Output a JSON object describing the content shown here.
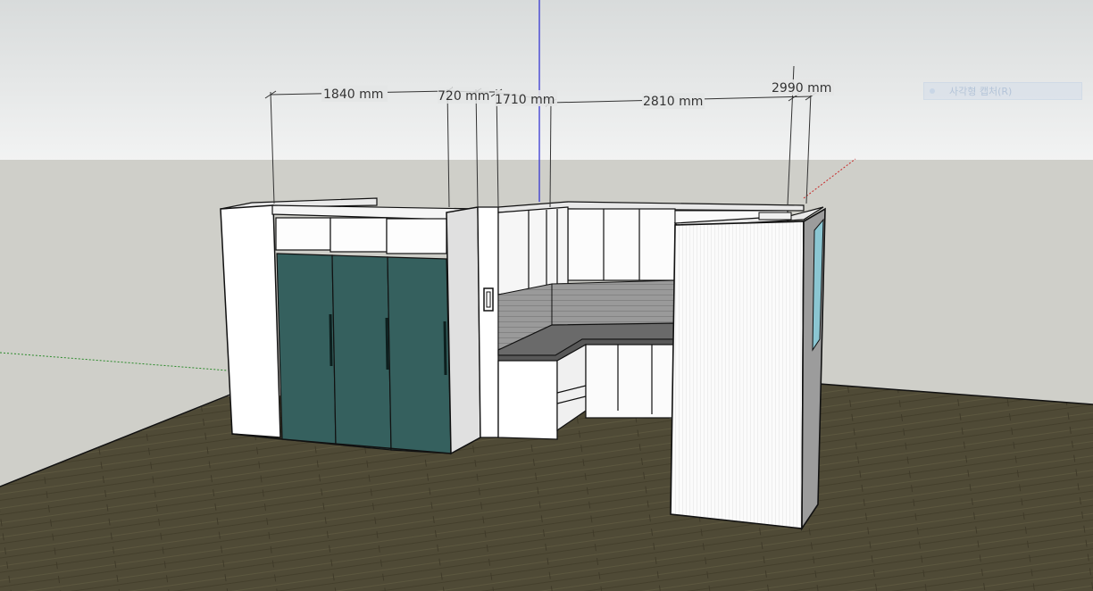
{
  "dimensions": {
    "d1": "1840 mm",
    "d2": "720 mm",
    "d3": "1710 mm",
    "d4": "2810 mm",
    "d5": "2990 mm"
  },
  "overlay": {
    "capture_label": "사각형 캡처(R)"
  },
  "colors": {
    "sky_top": "#e6e8e8",
    "ground_plane": "#cfcfc9",
    "floor": "#4e4a35",
    "wardrobe_door": "#35605e",
    "axis_blue": "#2a2ad0",
    "axis_green": "#2a8a2a",
    "axis_red": "#c82828"
  }
}
